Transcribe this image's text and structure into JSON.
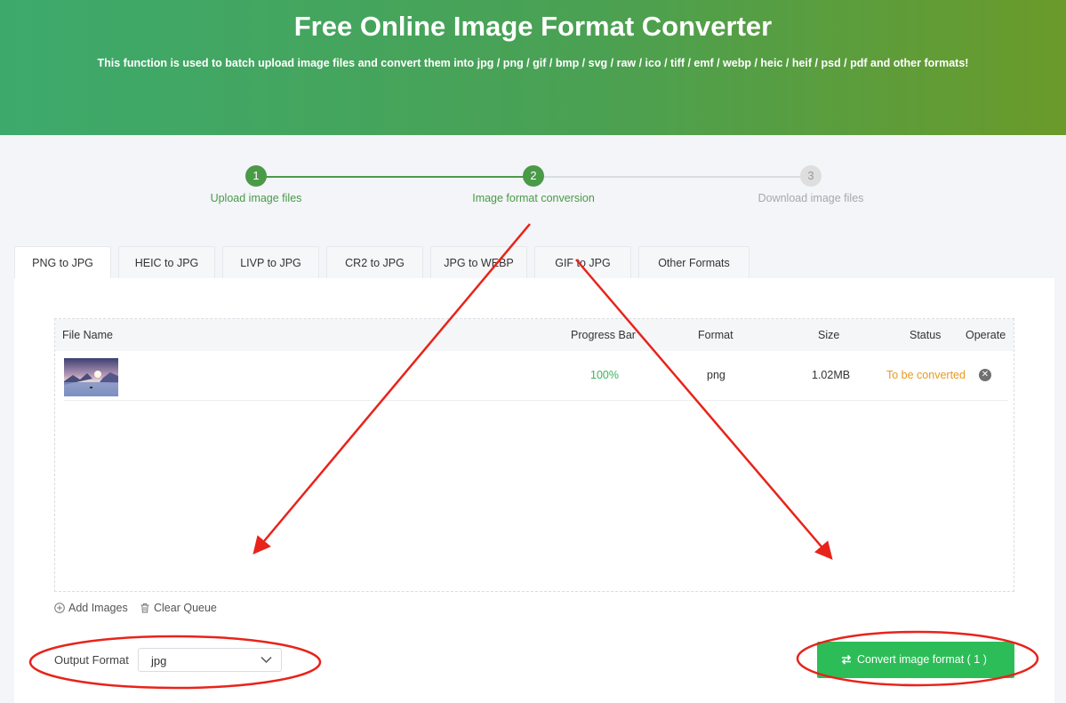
{
  "hero": {
    "title": "Free Online Image Format Converter",
    "subtitle": "This function is used to batch upload image files and convert them into jpg / png / gif / bmp / svg / raw / ico / tiff / emf / webp / heic / heif / psd / pdf and other formats!"
  },
  "steps": [
    {
      "number": "1",
      "label": "Upload image files",
      "state": "done"
    },
    {
      "number": "2",
      "label": "Image format conversion",
      "state": "active"
    },
    {
      "number": "3",
      "label": "Download image files",
      "state": "pending"
    }
  ],
  "tabs": [
    {
      "label": "PNG to JPG",
      "active": true
    },
    {
      "label": "HEIC to JPG",
      "active": false
    },
    {
      "label": "LIVP to JPG",
      "active": false
    },
    {
      "label": "CR2 to JPG",
      "active": false
    },
    {
      "label": "JPG to WEBP",
      "active": false
    },
    {
      "label": "GIF to JPG",
      "active": false
    },
    {
      "label": "Other Formats",
      "active": false
    }
  ],
  "table": {
    "headers": {
      "file_name": "File Name",
      "progress": "Progress Bar",
      "format": "Format",
      "size": "Size",
      "status": "Status",
      "operate": "Operate"
    },
    "rows": [
      {
        "progress": "100%",
        "format": "png",
        "size": "1.02MB",
        "status": "To be converted",
        "remove_icon": "close-circle-icon"
      }
    ]
  },
  "queue_actions": {
    "add_images": "Add Images",
    "clear_queue": "Clear Queue"
  },
  "output": {
    "label": "Output Format",
    "selected": "jpg"
  },
  "convert_button": {
    "label": "Convert image format ( 1 )"
  },
  "colors": {
    "primary_green": "#4a9a48",
    "button_green": "#2dbd58",
    "status_orange": "#e69a1f",
    "annotation_red": "#e8231a"
  }
}
